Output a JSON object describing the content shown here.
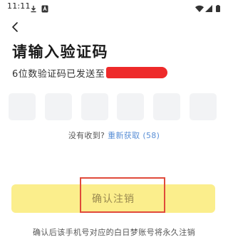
{
  "status_bar": {
    "time": "11:11",
    "icons_left": [
      "download-icon",
      "app-notification-icon"
    ],
    "icons_right": [
      "wifi-icon",
      "cellular-signal-icon",
      "battery-icon"
    ]
  },
  "header": {
    "back_icon": "chevron-left-icon",
    "title": "请输入验证码",
    "subtitle_prefix": "6位数验证码已发送至"
  },
  "code_input": {
    "length": 6,
    "digits": [
      "",
      "",
      "",
      "",
      "",
      ""
    ]
  },
  "resend": {
    "hint": "没有收到?",
    "link": "重新获取",
    "countdown": "(58)"
  },
  "confirm_button": {
    "label": "确认注销"
  },
  "footer": {
    "note": "确认后该手机号对应的白日梦账号将永久注销"
  },
  "colors": {
    "title": "#1a1a1a",
    "link": "#5a8fd6",
    "button_bg": "#fbee8c",
    "button_text": "#9a8a50",
    "code_box_bg": "#f2f3f5",
    "redaction": "#ee2a2a",
    "highlight": "#e04a3a"
  }
}
